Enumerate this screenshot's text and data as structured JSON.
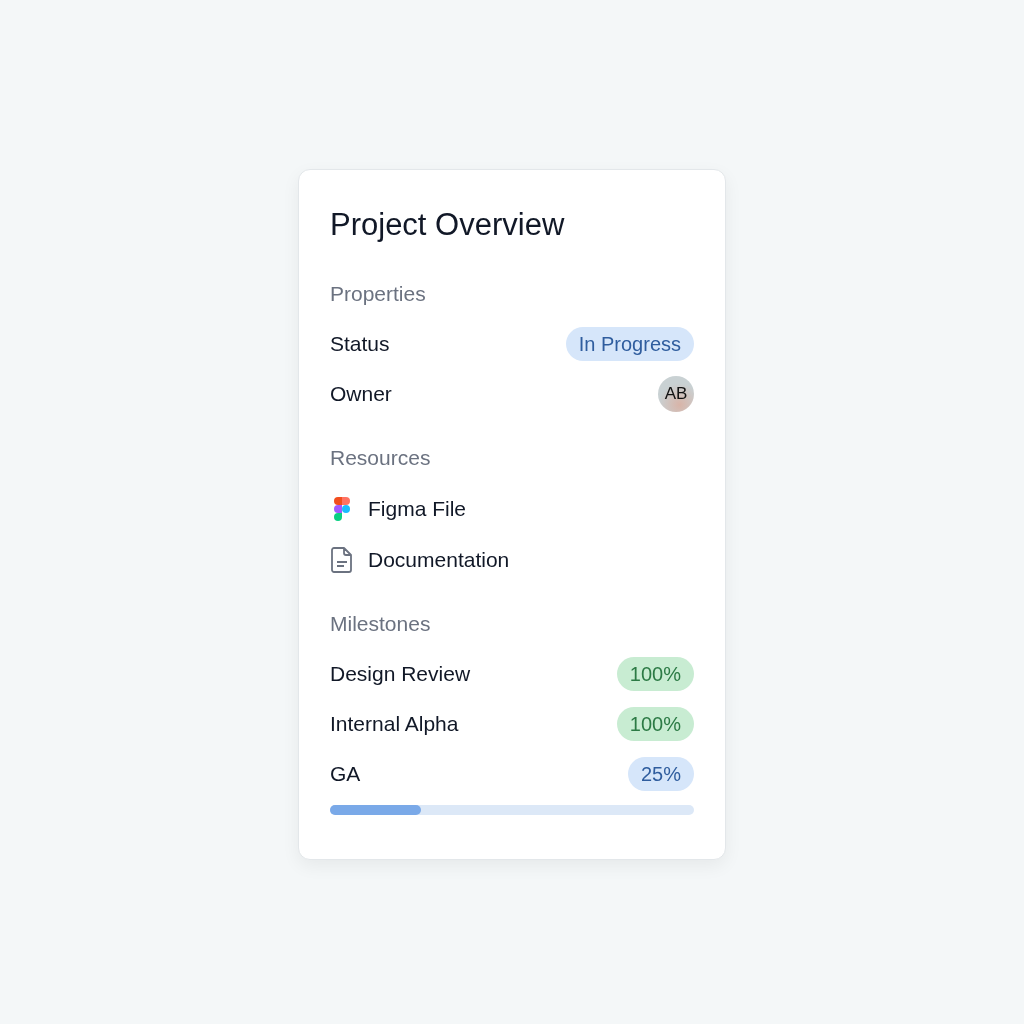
{
  "title": "Project Overview",
  "properties": {
    "heading": "Properties",
    "status": {
      "label": "Status",
      "value": "In Progress"
    },
    "owner": {
      "label": "Owner",
      "initials": "AB"
    }
  },
  "resources": {
    "heading": "Resources",
    "items": [
      {
        "kind": "figma",
        "label": "Figma File"
      },
      {
        "kind": "document",
        "label": "Documentation"
      }
    ]
  },
  "milestones": {
    "heading": "Milestones",
    "items": [
      {
        "name": "Design Review",
        "kind": "complete",
        "percent": "100%"
      },
      {
        "name": "Internal Alpha",
        "kind": "complete",
        "percent": "100%"
      },
      {
        "name": "GA",
        "kind": "active",
        "percent": "25%",
        "level": 0.25
      }
    ]
  }
}
